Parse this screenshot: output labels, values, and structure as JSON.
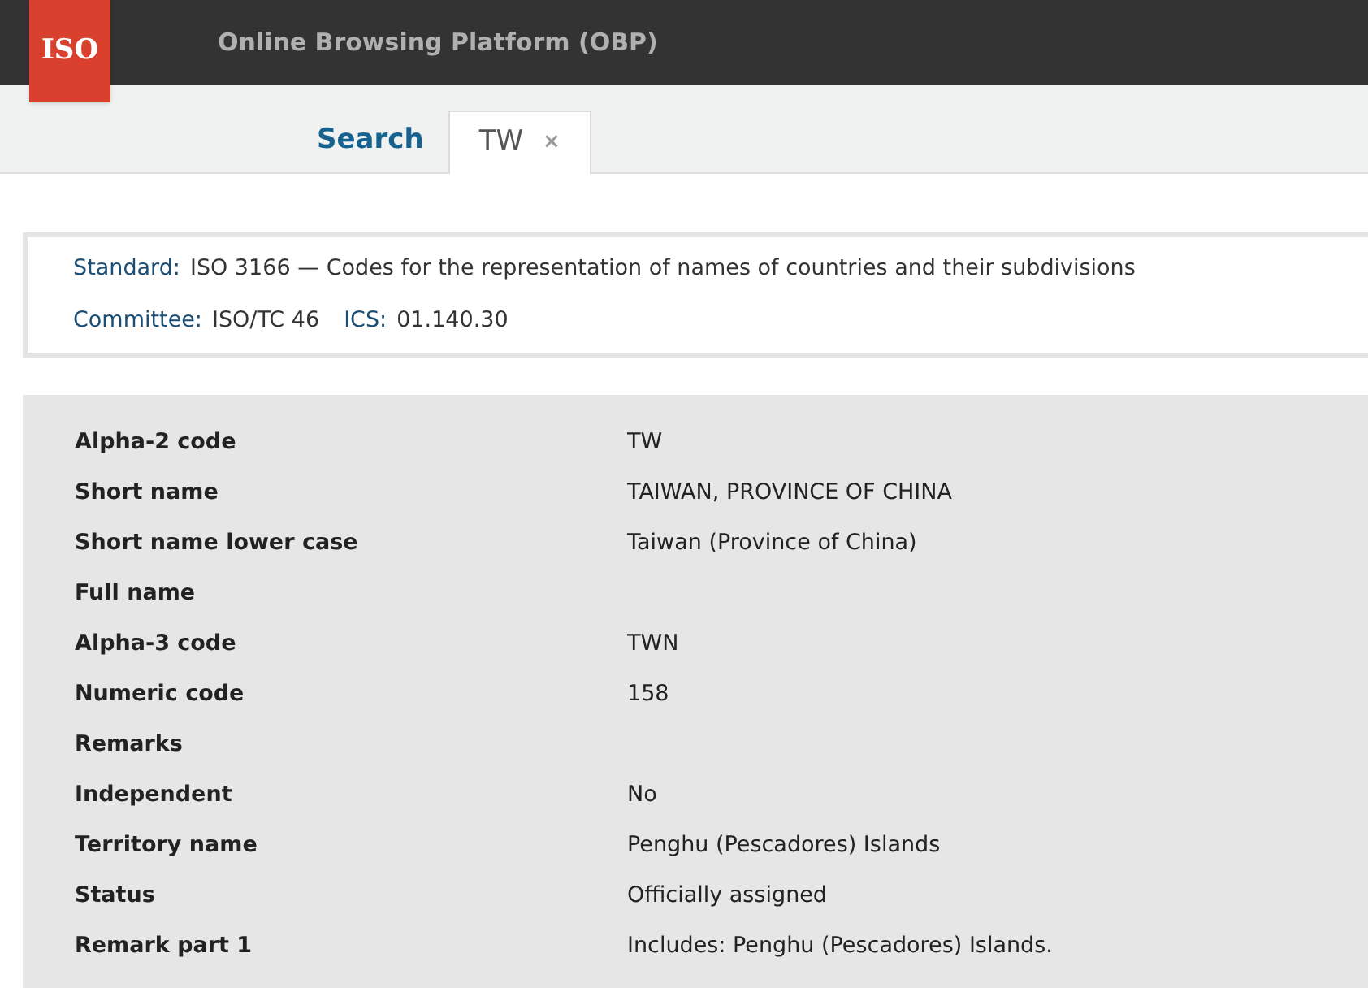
{
  "header": {
    "logo": "ISO",
    "title": "Online Browsing Platform (OBP)"
  },
  "tabs": [
    {
      "label": "Search",
      "selected": false
    },
    {
      "label": "TW",
      "selected": true,
      "close": "×"
    }
  ],
  "info": {
    "lines": [
      [
        {
          "label": "Standard:",
          "value": "ISO 3166 — Codes for the representation of names of countries and their subdivisions"
        }
      ],
      [
        {
          "label": "Committee:",
          "value": "ISO/TC 46"
        },
        {
          "label": "ICS:",
          "value": "01.140.30"
        }
      ]
    ]
  },
  "fields": [
    {
      "label": "Alpha-2 code",
      "value": "TW"
    },
    {
      "label": "Short name",
      "value": "TAIWAN, PROVINCE OF CHINA"
    },
    {
      "label": "Short name lower case",
      "value": "Taiwan (Province of China)"
    },
    {
      "label": "Full name"
    },
    {
      "label": "Alpha-3 code",
      "value": "TWN"
    },
    {
      "label": "Numeric code",
      "value": "158"
    },
    {
      "label": "Remarks"
    },
    {
      "label": "Independent",
      "value": "No"
    },
    {
      "label": "Territory name",
      "value": "Penghu (Pescadores) Islands"
    },
    {
      "label": "Status",
      "value": "Officially assigned"
    },
    {
      "label": "Remark part 1",
      "value": "Includes: Penghu (Pescadores) Islands."
    }
  ]
}
